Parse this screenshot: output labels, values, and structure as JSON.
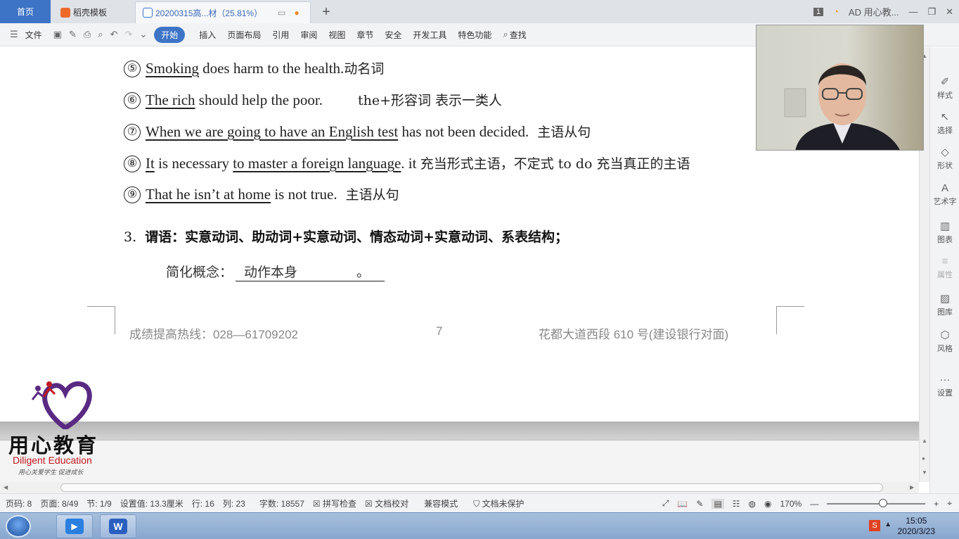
{
  "tabs": {
    "home": "首页",
    "template": "稻壳模板",
    "document": "20200315高...材（25.81%）"
  },
  "window": {
    "badge": "1",
    "user": "AD 用心教..."
  },
  "toolbar": {
    "file": "文件",
    "start": "开始",
    "insert": "插入",
    "layout": "页面布局",
    "reference": "引用",
    "review": "审阅",
    "view": "视图",
    "section": "章节",
    "security": "安全",
    "devtools": "开发工具",
    "features": "特色功能",
    "search": "查找"
  },
  "content": {
    "l5": {
      "num": "⑤",
      "u1": "Smoking",
      "rest": " does harm to the health.",
      "note": "动名词"
    },
    "l6": {
      "num": "⑥",
      "u1": "The rich",
      "rest": " should help the poor.",
      "note": "the+形容词  表示一类人"
    },
    "l7": {
      "num": "⑦",
      "u1": "When we are going to have an English test",
      "rest": " has not been decided.",
      "note": "主语从句"
    },
    "l8": {
      "num": "⑧",
      "u1": "It",
      "mid": " is necessary ",
      "u2": "to master a foreign language",
      "rest": ". it ",
      "note": "充当形式主语，不定式 to do 充当真正的主语"
    },
    "l9": {
      "num": "⑨",
      "u1": "That he isn’t at home",
      "rest": " is not true.",
      "note": "主语从句"
    },
    "section3": {
      "num": "3.",
      "text": "谓语：实意动词、助动词+实意动词、情态动词+实意动词、系表结构；"
    },
    "concept": {
      "label": "简化概念：",
      "answer": "动作本身",
      "end": "。"
    }
  },
  "footer": {
    "hotline": "成绩提高热线：028—61709202",
    "page": "7",
    "address": "花都大道西段 610 号(建设银行对面)"
  },
  "logo": {
    "cn": "用心教育",
    "en": "Diligent  Education",
    "sub": "用心关爱学生  促进成长"
  },
  "right_panel": {
    "style": "样式",
    "select": "选择",
    "shape": "形状",
    "art": "艺术字",
    "chart": "图表",
    "property": "属性",
    "library": "图库",
    "theme": "风格",
    "settings": "设置"
  },
  "status": {
    "pageno": "页码: 8",
    "pages": "页面: 8/49",
    "section": "节: 1/9",
    "setting": "设置值: 13.3厘米",
    "row": "行: 16",
    "col": "列: 23",
    "words": "字数: 18557",
    "spell": "拼写检查",
    "proof": "文档校对",
    "compat": "兼容模式",
    "protect": "文档未保护",
    "zoom": "170%"
  },
  "clock": {
    "time": "15:05",
    "date": "2020/3/23"
  },
  "colors": {
    "accent": "#3d74c6",
    "logo_red": "#c0181f",
    "logo_purple": "#5a2a82"
  }
}
